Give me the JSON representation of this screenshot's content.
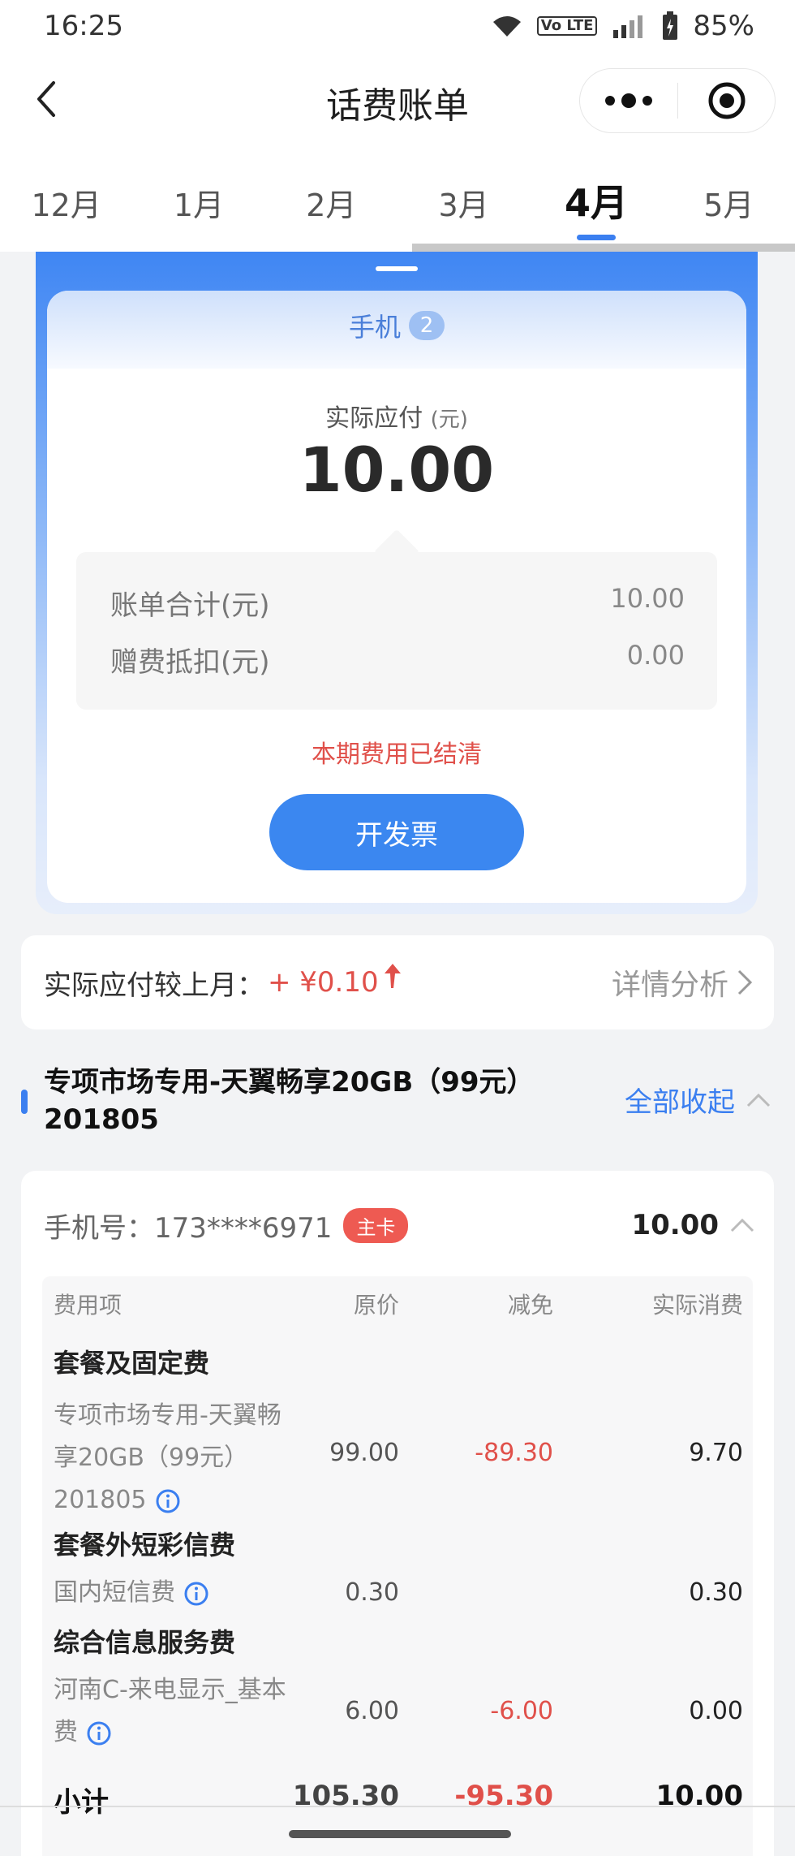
{
  "status_bar": {
    "time": "16:25",
    "battery": "85%",
    "network": "Vo LTE"
  },
  "header": {
    "title": "话费账单"
  },
  "month_tabs": [
    {
      "label": "12月",
      "active": false
    },
    {
      "label": "1月",
      "active": false
    },
    {
      "label": "2月",
      "active": false
    },
    {
      "label": "3月",
      "active": false
    },
    {
      "label": "4月",
      "active": true
    },
    {
      "label": "5月",
      "active": false
    }
  ],
  "bill": {
    "device_tab": "手机",
    "device_count": "2",
    "pay_label": "实际应付",
    "pay_unit": "(元)",
    "pay_amount": "10.00",
    "total_label": "账单合计(元)",
    "total_value": "10.00",
    "gift_label": "赠费抵扣(元)",
    "gift_value": "0.00",
    "settled_text": "本期费用已结清",
    "invoice_button": "开发票"
  },
  "compare": {
    "label": "实际应付较上月：",
    "delta": "+ ¥0.10",
    "detail_link": "详情分析"
  },
  "plan": {
    "title_line1": "专项市场专用-天翼畅享20GB（99元）",
    "title_line2": "201805",
    "collapse_all": "全部收起"
  },
  "detail": {
    "phone_label": "手机号：173****6971",
    "primary_badge": "主卡",
    "phone_total": "10.00",
    "columns": [
      "费用项",
      "原价",
      "减免",
      "实际消费"
    ],
    "groups": {
      "package": "套餐及固定费",
      "sms": "套餐外短彩信费",
      "info": "综合信息服务费"
    },
    "items": {
      "package_name_l1": "专项市场专用-天翼畅",
      "package_name_l2": "享20GB（99元）",
      "package_name_l3": "201805",
      "package_original": "99.00",
      "package_discount": "-89.30",
      "package_actual": "9.70",
      "sms_name": "国内短信费",
      "sms_original": "0.30",
      "sms_actual": "0.30",
      "caller_name_l1": "河南C-来电显示_基本",
      "caller_name_l2": "费",
      "caller_original": "6.00",
      "caller_discount": "-6.00",
      "caller_actual": "0.00"
    },
    "subtotal": {
      "label": "小计",
      "original": "105.30",
      "discount": "-95.30",
      "actual": "10.00"
    }
  },
  "colors": {
    "accent": "#3b7ff0",
    "alert": "#e0504a"
  }
}
